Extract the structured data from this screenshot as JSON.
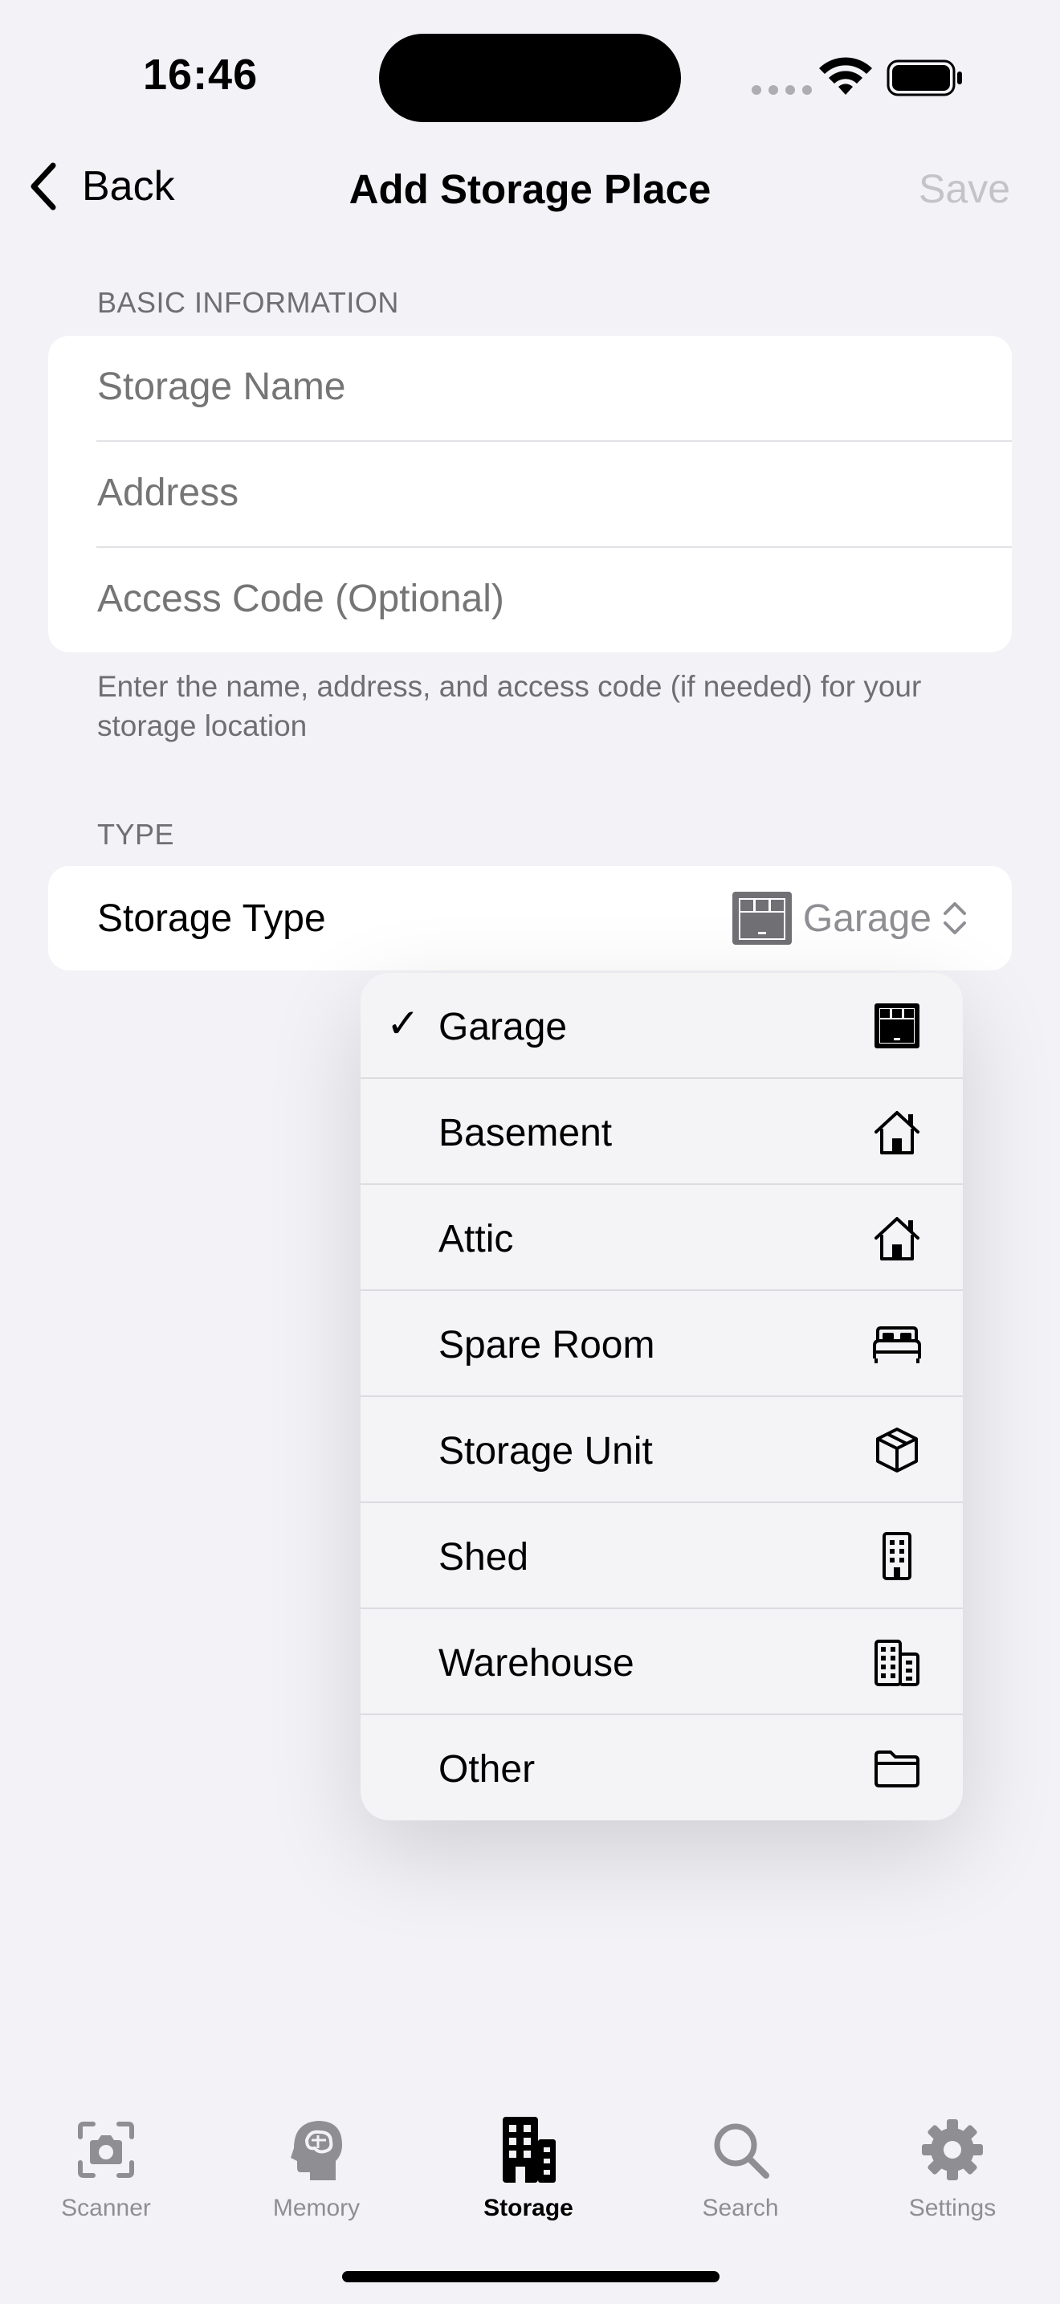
{
  "status_bar": {
    "time": "16:46"
  },
  "nav": {
    "back_label": "Back",
    "title": "Add Storage Place",
    "save_label": "Save"
  },
  "basic_info": {
    "header": "BASIC INFORMATION",
    "fields": [
      {
        "placeholder": "Storage Name",
        "value": ""
      },
      {
        "placeholder": "Address",
        "value": ""
      },
      {
        "placeholder": "Access Code (Optional)",
        "value": ""
      }
    ],
    "footer": "Enter the name, address, and access code (if needed) for your storage location"
  },
  "type_section": {
    "header": "TYPE",
    "row_label": "Storage Type",
    "selected_value": "Garage",
    "selected_icon": "garage-icon"
  },
  "menu": {
    "items": [
      {
        "label": "Garage",
        "icon": "garage-icon",
        "checked": true
      },
      {
        "label": "Basement",
        "icon": "house-icon",
        "checked": false
      },
      {
        "label": "Attic",
        "icon": "house-icon",
        "checked": false
      },
      {
        "label": "Spare Room",
        "icon": "bed-icon",
        "checked": false
      },
      {
        "label": "Storage Unit",
        "icon": "box-icon",
        "checked": false
      },
      {
        "label": "Shed",
        "icon": "building-icon",
        "checked": false
      },
      {
        "label": "Warehouse",
        "icon": "buildings-icon",
        "checked": false
      },
      {
        "label": "Other",
        "icon": "folder-icon",
        "checked": false
      }
    ],
    "check_glyph": "✓"
  },
  "tab_bar": {
    "tabs": [
      {
        "label": "Scanner",
        "icon": "camera-icon",
        "active": false
      },
      {
        "label": "Memory",
        "icon": "brain-head-icon",
        "active": false
      },
      {
        "label": "Storage",
        "icon": "building-icon",
        "active": true
      },
      {
        "label": "Search",
        "icon": "search-icon",
        "active": false
      },
      {
        "label": "Settings",
        "icon": "gear-icon",
        "active": false
      }
    ]
  },
  "colors": {
    "background": "#F2F2F7",
    "secondary_text": "#6E6E73",
    "placeholder": "#C0C0C4",
    "inactive_tab": "#8E8E93"
  }
}
